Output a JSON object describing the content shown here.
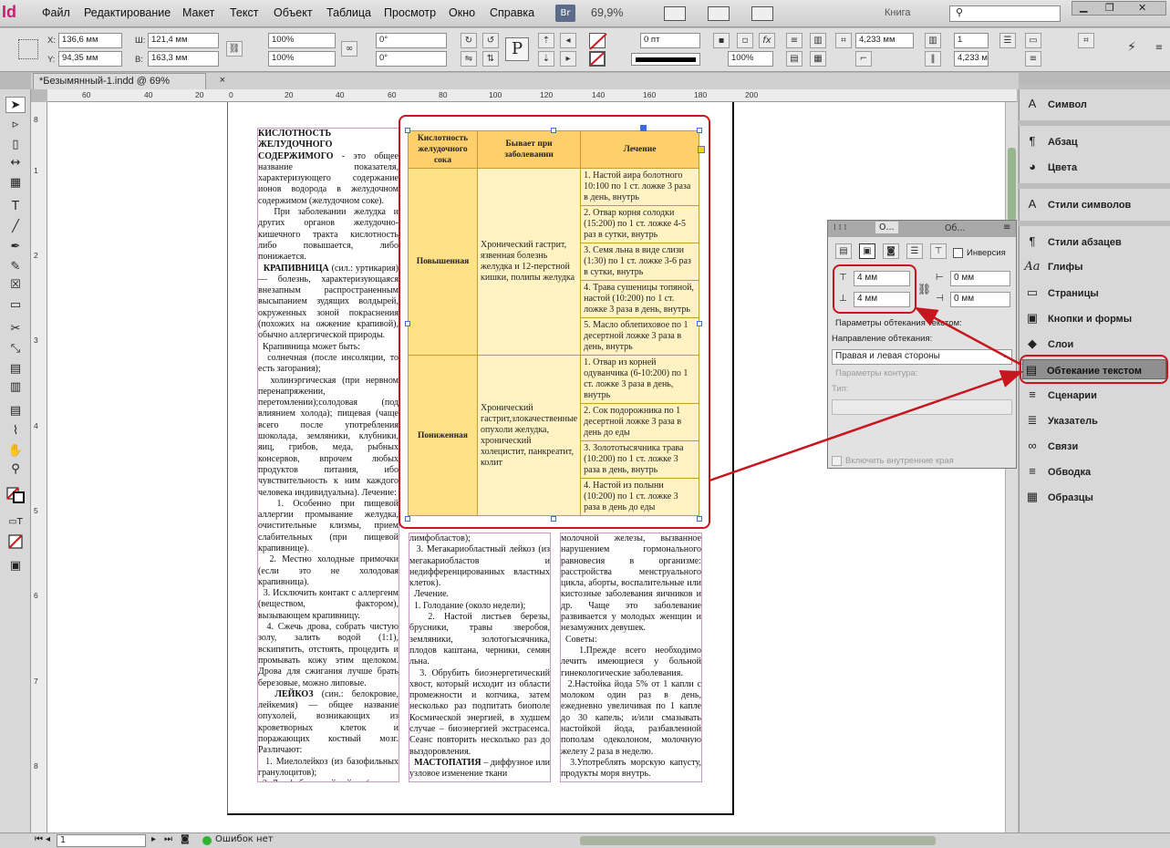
{
  "app": {
    "logo": "Id",
    "menu": [
      "Файл",
      "Редактирование",
      "Макет",
      "Текст",
      "Объект",
      "Таблица",
      "Просмотр",
      "Окно",
      "Справка"
    ],
    "br": "Br",
    "zoom": "69,9%",
    "workspace": "Книга"
  },
  "control": {
    "x_label": "X:",
    "x": "136,6 мм",
    "y_label": "Y:",
    "y": "94,35 мм",
    "w_label": "Ш:",
    "w": "121,4 мм",
    "h_label": "В:",
    "h": "163,3 мм",
    "scale_x": "100%",
    "scale_y": "100%",
    "angle": "0°",
    "shear": "0°",
    "stroke_weight": "0 пт",
    "opacity": "100%",
    "gap1": "4,233 мм",
    "gap2": "4,233 мм",
    "columns": "1",
    "spacing": "4,233 мм"
  },
  "doc_tab": "*Безымянный-1.indd @ 69%",
  "ruler_h": [
    "60",
    "40",
    "20",
    "0",
    "20",
    "40",
    "60",
    "80",
    "100",
    "120",
    "140",
    "160",
    "180",
    "200"
  ],
  "ruler_v": [
    "8",
    "1",
    "2",
    "3",
    "4",
    "5",
    "6",
    "7",
    "8"
  ],
  "col1_html": "<b>КИСЛОТНОСТЬ ЖЕЛУДОЧНОГО СОДЕРЖИМОГО</b> - это общее название показателя, характеризующего содержание ионов водорода в желудочном содержимом (желудочном соке).<br>&nbsp;&nbsp;При заболевании желудка и других органов желудочно-кишечного тракта кислотность либо повышается, либо понижается.<br>&nbsp;&nbsp;<b>КРАПИВНИЦА</b> (сил.: уртикария) — болезнь, характеризующаяся внезапным распространенным высыпанием зудящих волдырей, окруженных зоной покраснения (похожих на ожжение крапивой), обычно аллергической природы.<br>&nbsp;&nbsp;Крапивница может быть:<br>&nbsp;&nbsp;солнечная (после инсоляции, то есть загорания);<br>&nbsp;&nbsp;холинэргическая (при нервном перенапряжении, перетомлении);солодовая (под влиянием холода); пищевая (чаще всего после употребления шоколада, земляники, клубники, яиц, грибов, меда, рыбных консервов, впрочем любых продуктов питания, ибо чувствительность к ним каждого человека индивидуальна). Лечение:<br>&nbsp;&nbsp;1. Особенно при пищевой аллергии промывание желудка, очистительные клизмы, прием слабительных (при пищевой крапивнице).<br>&nbsp;&nbsp;2. Местно холодные примочки (если это не холодовая крапивница).<br>&nbsp;&nbsp;3. Исключить контакт с аллергенм (веществом, фактором), вызывающем крапивницу.<br>&nbsp;&nbsp;4. Сжечь дрова, собрать чистую золу, залить водой (1:1), вскипятить, отстоять, процедить и промывать кожу этим щелоком. Дрова для сжигания лучше брать березовые, можно липовые.<br>&nbsp;&nbsp;<b>ЛЕЙКОЗ</b> (син.: белокровие, лейкемия) — общее название опухолей, возникающих из кроветворных клеток и поражающих костный мозг. Различают:<br>&nbsp;&nbsp;1. Миелолейкоз (из базофильных гранулоцитов);<br>&nbsp;&nbsp;2. Лимфобластный лейкоз (из",
  "col2_html": "лимфобластов);<br>&nbsp;&nbsp;3. Мегакариобластный лейкоз (из мегакариобластов и недифференцированных властных клеток).<br>&nbsp;&nbsp;Лечение.<br>&nbsp;&nbsp;1. Голодание (около недели);<br>&nbsp;&nbsp;2. Настой листьев березы, брусники, травы зверобоя, земляники, золотогысячника, плодов каштана, черники, семян льна.<br>&nbsp;&nbsp;3. Обрубить биоэнергетический хвост, который исходит из области промежности и копчика, затем несколько раз подпитать биополе Космической энергией, в худшем случае – биоэнергией экстрасенса. Сеанс повторить несколько раз до выздоровления.<br>&nbsp;&nbsp;<b>МАСТОПАТИЯ</b> – диффузное или узловое изменение ткани",
  "col3_html": "молочной железы, вызванное нарушением гормонального равновесия в организме: расстройства менструального цикла, аборты, воспалительные или кистозные заболевания яичников и др. Чаще это заболевание развивается у молодых женщин и незамужних девушек.<br>&nbsp;&nbsp;Советы:<br>&nbsp;&nbsp;1.Прежде всего необходимо лечить имеющиеся у больной гинекологические заболевания.<br>&nbsp;&nbsp;2.Настойка йода 5% от 1 капли с молоком один раз в день, ежедневно увеличивая по 1 капле до 30 капель; и/или смазывать настойкой йода, разбавленной пополам одеколоном, молочную железу 2 раза в неделю.<br>&nbsp;&nbsp;3.Употреблять морскую капусту, продукты моря внутрь.",
  "table": {
    "headers": [
      "Кислотность желудочного сока",
      "Бывает при заболевании",
      "Лечение"
    ],
    "rows": [
      {
        "acidity": "Повышенная",
        "disease": "Хронический гастрит, язвенная болезнь желудка и 12-перстной кишки, полипы желудка",
        "treatments": [
          "1. Настой аира болотного 10:100 по 1 ст. ложке 3 раза в день, внутрь",
          "2. Отвар корня солодки (15:200) по 1 ст. ложке 4-5 раз в сутки, внутрь",
          "3. Семя льна в виде слизи (1:30) по 1 ст. ложке 3-6 раз в сутки, внутрь",
          "4. Трава сушеницы топяной, настой (10:200) по 1 ст. ложке 3 раза в день, внутрь",
          "5. Масло облепиховое по 1 десертной ложке 3 раза в день, внутрь"
        ]
      },
      {
        "acidity": "Пониженная",
        "disease": "Хронический гастрит,злокачественные опухоли желудка, хронический холецистит, панкреатит, колит",
        "treatments": [
          "1. Отвар из корней одуванчика (6-10:200) по 1 ст. ложке 3 раза в день, внутрь",
          "2. Сок подорожника по 1 десертной ложке 3 раза в день до еды",
          "3. Золототысячника трава (10:200) по 1 ст. ложке 3 раза в день, внутрь",
          "4. Настой из полыни (10:200) по 1 ст. ложке 3 раза в день до еды"
        ]
      }
    ]
  },
  "wrap_panel": {
    "tabs": [
      "О...",
      "Об..."
    ],
    "invert": "Инверсия",
    "top": "4 мм",
    "bottom": "4 мм",
    "left": "0 мм",
    "right": "0 мм",
    "options_title": "Параметры обтекания текстом:",
    "direction_label": "Направление обтекания:",
    "direction": "Правая и левая стороны",
    "contour_title": "Параметры контура:",
    "type_label": "Тип:",
    "inner_edges": "Включить внутренние края"
  },
  "panels": [
    {
      "icon": "A",
      "label": "Символ"
    },
    {
      "icon": "¶",
      "label": "Абзац"
    },
    {
      "icon": "◕",
      "label": "Цвета"
    },
    {
      "icon": "A",
      "label": "Стили символов"
    },
    {
      "icon": "¶",
      "label": "Стили абзацев"
    },
    {
      "icon": "Aa",
      "label": "Глифы"
    },
    {
      "icon": "▭",
      "label": "Страницы"
    },
    {
      "icon": "▣",
      "label": "Кнопки и формы"
    },
    {
      "icon": "◆",
      "label": "Слои"
    },
    {
      "icon": "▤",
      "label": "Обтекание текстом"
    },
    {
      "icon": "≡",
      "label": "Сценарии"
    },
    {
      "icon": "≣",
      "label": "Указатель"
    },
    {
      "icon": "∞",
      "label": "Связи"
    },
    {
      "icon": "≡",
      "label": "Обводка"
    },
    {
      "icon": "▦",
      "label": "Образцы"
    }
  ],
  "status": {
    "page": "1",
    "errors": "Ошибок нет"
  },
  "colors": {
    "highlight": "#c8161e",
    "header": "#ffcf6b",
    "cell": "#fff3c4"
  }
}
